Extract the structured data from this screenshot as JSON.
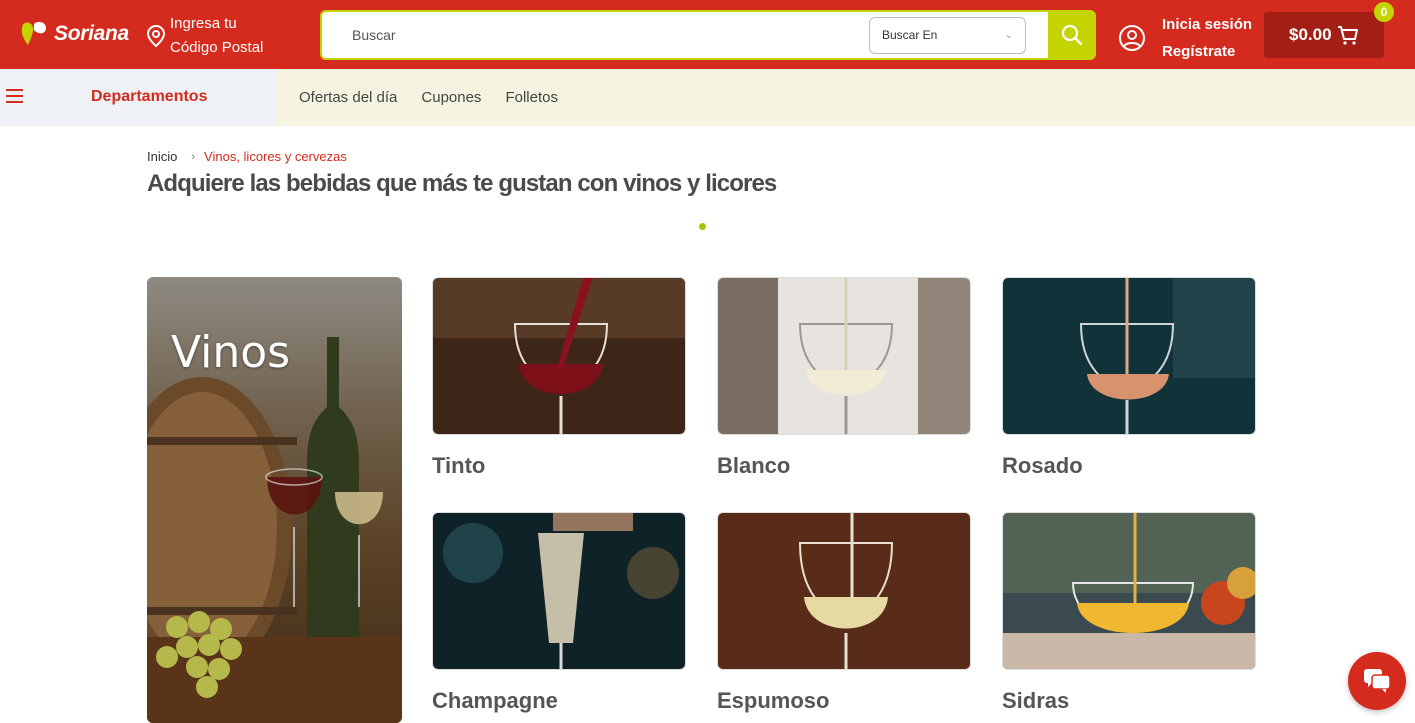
{
  "header": {
    "logo_text": "Soriana",
    "postal_line1": "Ingresa tu",
    "postal_line2": "Código Postal",
    "search_placeholder": "Buscar",
    "search_in_label": "Buscar En",
    "login_label": "Inicia sesión",
    "register_label": "Regístrate",
    "cart_total": "$0.00",
    "cart_count": "0"
  },
  "nav": {
    "departments_label": "Departamentos",
    "links": [
      "Ofertas del día",
      "Cupones",
      "Folletos"
    ]
  },
  "breadcrumb": {
    "home": "Inicio",
    "current": "Vinos, licores y cervezas"
  },
  "page_title": "Adquiere las bebidas que más te gustan con vinos y licores",
  "banner": {
    "title": "Vinos"
  },
  "categories": [
    {
      "label": "Tinto"
    },
    {
      "label": "Blanco"
    },
    {
      "label": "Rosado"
    },
    {
      "label": "Champagne"
    },
    {
      "label": "Espumoso"
    },
    {
      "label": "Sidras"
    }
  ],
  "colors": {
    "brand_red": "#d52b1e",
    "brand_lime": "#c3d400",
    "nav_bg": "#f4f4e0"
  }
}
